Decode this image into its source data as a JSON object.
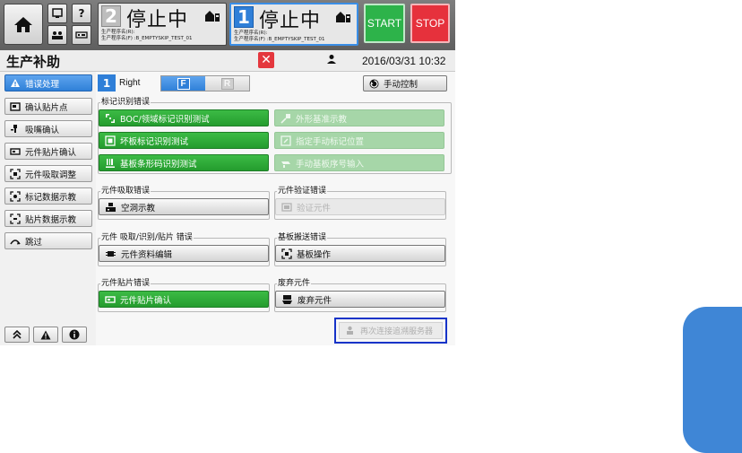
{
  "top_bar": {
    "lanes": [
      {
        "number": "2",
        "status": "停止中",
        "program_line1": "生产程序名(R):",
        "program_line2": "生产程序名(F) :B_EMPTYSKIP_TEST_01"
      },
      {
        "number": "1",
        "status": "停止中",
        "program_line1": "生产程序名(R):",
        "program_line2": "生产程序名(F) :B_EMPTYSKIP_TEST_01"
      }
    ],
    "start_label": "START",
    "stop_label": "STOP",
    "help_glyph": "?"
  },
  "title_bar": {
    "title": "生产补助",
    "close_glyph": "✕",
    "datetime": "2016/03/31 10:32"
  },
  "sidebar": {
    "items": [
      {
        "label": "错误处理",
        "icon": "warning-wrench-icon"
      },
      {
        "label": "确认贴片点",
        "icon": "placement-point-icon"
      },
      {
        "label": "吸嘴确认",
        "icon": "nozzle-icon"
      },
      {
        "label": "元件贴片确认",
        "icon": "component-mount-icon"
      },
      {
        "label": "元件吸取调整",
        "icon": "pickup-adjust-icon"
      },
      {
        "label": "标记数据示教",
        "icon": "mark-data-icon"
      },
      {
        "label": "贴片数据示教",
        "icon": "placement-data-icon"
      },
      {
        "label": "跳过",
        "icon": "skip-icon"
      }
    ],
    "active_index": 0
  },
  "content": {
    "lane_number": "1",
    "lane_name": "Right",
    "front_label": "F",
    "rear_label": "R",
    "manual_control_label": "手动控制",
    "groups": {
      "mark_recognition": {
        "title": "标记识别错误",
        "buttons": [
          {
            "label": "BOC/领域标记识别测试",
            "state": "enabled"
          },
          {
            "label": "外形基准示教",
            "state": "disabled"
          },
          {
            "label": "坏板标记识别测试",
            "state": "enabled"
          },
          {
            "label": "指定手动标记位置",
            "state": "disabled"
          },
          {
            "label": "基板条形码识别测试",
            "state": "enabled"
          },
          {
            "label": "手动基板序号输入",
            "state": "disabled"
          }
        ]
      },
      "pickup": {
        "title": "元件吸取错误",
        "button": "空洞示教"
      },
      "verify": {
        "title": "元件验证错误",
        "button": "验证元件"
      },
      "pick_recog_place": {
        "title": "元件 吸取/识别/贴片 错误",
        "button": "元件资料编辑"
      },
      "board_transfer": {
        "title": "基板搬送错误",
        "button": "基板操作"
      },
      "placement": {
        "title": "元件贴片错误",
        "button": "元件贴片确认"
      },
      "discard": {
        "title": "废弃元件",
        "button": "废弃元件"
      }
    },
    "reconnect_label": "再次连接追溯服务器"
  },
  "colors": {
    "accent_blue": "#2f7fd8",
    "action_green": "#2ba136",
    "stop_red": "#e6313c",
    "start_green": "#2db34a",
    "highlight_border": "#1633c8",
    "side_tab": "#3f86d6"
  }
}
